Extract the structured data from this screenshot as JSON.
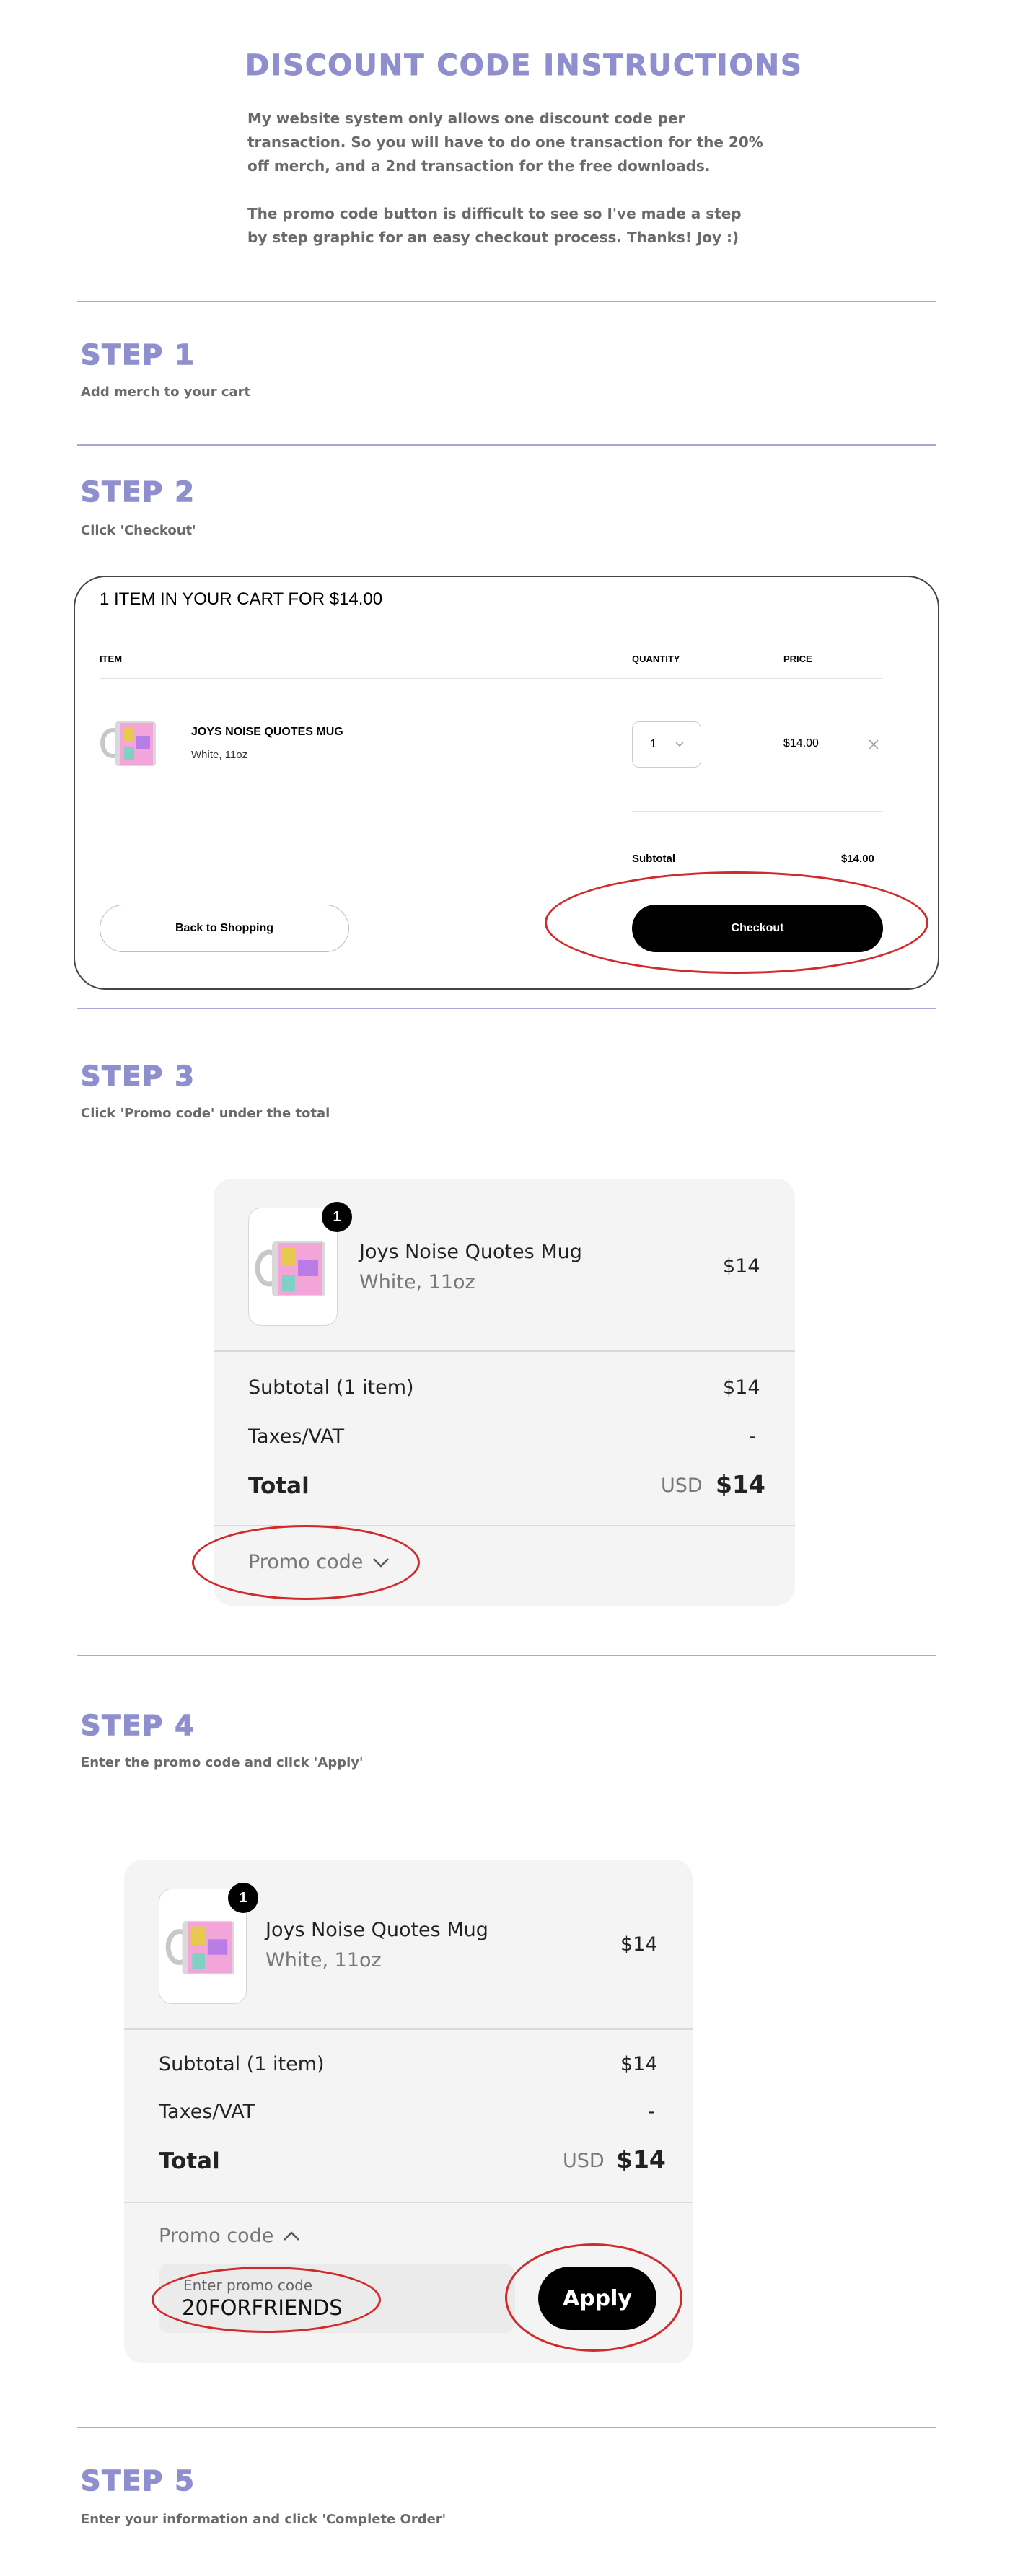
{
  "intro": {
    "title": "DISCOUNT CODE INSTRUCTIONS",
    "line1": "My website system only allows one discount code per",
    "line2": "transaction. So you will have to do one transaction for the 20%",
    "line3": "off merch, and a 2nd transaction for the free downloads.",
    "line4": "The promo code button is difficult to see so I've made a step",
    "line5": "by step graphic for an easy checkout process. Thanks! Joy :)"
  },
  "step1": {
    "title": "STEP 1",
    "subtitle": "Add merch to your cart"
  },
  "step2": {
    "title": "STEP 2",
    "subtitle": "Click 'Checkout'",
    "cart": {
      "heading": "1 ITEM IN YOUR CART FOR $14.00",
      "col_item": "ITEM",
      "col_quantity": "QUANTITY",
      "col_price": "PRICE",
      "product_name": "JOYS NOISE QUOTES MUG",
      "product_variant": "White, 11oz",
      "quantity": "1",
      "price": "$14.00",
      "subtotal_label": "Subtotal",
      "subtotal_value": "$14.00",
      "back_label": "Back to Shopping",
      "checkout_label": "Checkout"
    }
  },
  "step3": {
    "title": "STEP 3",
    "subtitle": "Click 'Promo code' under the total",
    "summary": {
      "badge": "1",
      "product_name": "Joys Noise Quotes Mug",
      "product_variant": "White, 11oz",
      "product_price": "$14",
      "subtotal_label": "Subtotal (1 item)",
      "subtotal_value": "$14",
      "taxes_label": "Taxes/VAT",
      "taxes_value": "-",
      "total_label": "Total",
      "currency": "USD",
      "total_value": "$14",
      "promo_label": "Promo code"
    }
  },
  "step4": {
    "title": "STEP 4",
    "subtitle": "Enter the promo code and click 'Apply'",
    "summary": {
      "badge": "1",
      "product_name": "Joys Noise Quotes Mug",
      "product_variant": "White, 11oz",
      "product_price": "$14",
      "subtotal_label": "Subtotal (1 item)",
      "subtotal_value": "$14",
      "taxes_label": "Taxes/VAT",
      "taxes_value": "-",
      "total_label": "Total",
      "currency": "USD",
      "total_value": "$14",
      "promo_label": "Promo code",
      "promo_placeholder": "Enter promo code",
      "promo_value": "20FORFRIENDS",
      "apply_label": "Apply"
    }
  },
  "step5": {
    "title": "STEP 5",
    "subtitle": "Enter your information and click 'Complete Order'"
  },
  "colors": {
    "accent": "#8f8fcf",
    "divider": "#a9a9d6",
    "highlight": "#d12a2a"
  }
}
